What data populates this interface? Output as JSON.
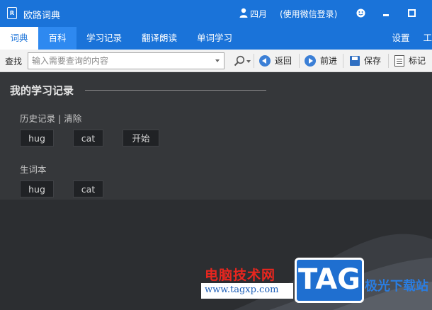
{
  "titlebar": {
    "logo_text": "R",
    "app_title": "欧路词典",
    "user_name": "四月",
    "login_hint": "(使用微信登录)"
  },
  "menu": {
    "items": [
      "词典",
      "百科",
      "学习记录",
      "翻译朗读",
      "单词学习",
      "设置",
      "工具"
    ]
  },
  "toolbar": {
    "search_label": "查找",
    "search_placeholder": "输入需要查询的内容",
    "back": "返回",
    "forward": "前进",
    "save": "保存",
    "mark": "标记"
  },
  "main": {
    "section_title": "我的学习记录",
    "history_label": "历史记录",
    "separator": "|",
    "clear_label": "清除",
    "history_words": [
      "hug",
      "cat",
      "开始"
    ],
    "notebook_label": "生词本",
    "notebook_words": [
      "hug",
      "cat"
    ]
  },
  "watermark": {
    "cn_text": "电脑技术网",
    "url": "www.tagxp.com",
    "badge": "TAG",
    "site": "极光下载站"
  },
  "colors": {
    "accent": "#1a73d9",
    "content_bg": "#2c2e31"
  }
}
